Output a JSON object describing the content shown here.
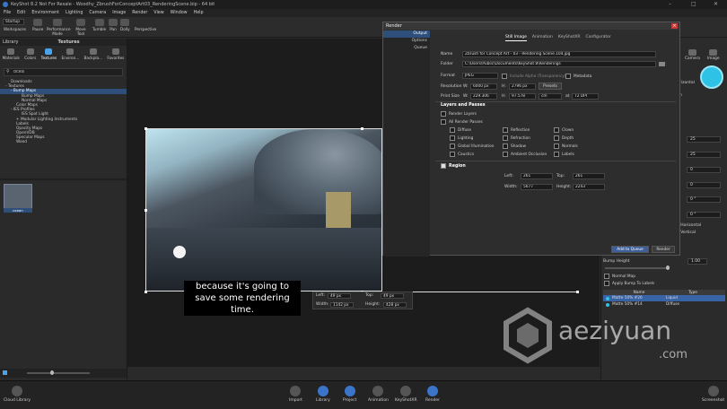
{
  "window": {
    "title": "KeyShot 8.2 Not For Resale - Woodhy_ZbrushForConceptArt03_RenderingScene.bip - 64 bit",
    "min_glyph": "–",
    "max_glyph": "□",
    "close_glyph": "✕"
  },
  "menu": [
    "File",
    "Edit",
    "Environment",
    "Lighting",
    "Camera",
    "Image",
    "Render",
    "View",
    "Window",
    "Help"
  ],
  "toolbar": {
    "workspace_select": "Startup",
    "items": [
      "Workspaces",
      "Pause",
      "Performance Mode",
      "Move Tool",
      "Tumble",
      "Pan",
      "Dolly",
      "Perspective"
    ]
  },
  "library": {
    "header": "Library",
    "panel_title": "Textures",
    "tabs": [
      "Materials",
      "Colors",
      "Textures",
      "Environ...",
      "Backpla...",
      "Favorites"
    ],
    "search_value": "ocea",
    "tree": [
      {
        "label": "Downloads",
        "indent": 1
      },
      {
        "label": "- Textures",
        "indent": 0
      },
      {
        "label": "- Bump Maps",
        "indent": 1,
        "selected": true
      },
      {
        "label": "Bump Maps",
        "indent": 2
      },
      {
        "label": "Normal Maps",
        "indent": 2
      },
      {
        "label": "Color Maps",
        "indent": 1
      },
      {
        "label": "- IES Profiles",
        "indent": 1
      },
      {
        "label": "IES Spot Light",
        "indent": 2
      },
      {
        "label": "+ Modular Lighting Instruments",
        "indent": 1
      },
      {
        "label": "Labels",
        "indent": 1
      },
      {
        "label": "Opacity Maps",
        "indent": 1
      },
      {
        "label": "OpenVDB",
        "indent": 1
      },
      {
        "label": "Specular Maps",
        "indent": 1
      },
      {
        "label": "Wood",
        "indent": 1
      }
    ],
    "thumb_label": "ocean"
  },
  "region_box": {
    "left_label": "Left:",
    "left_value": "49 px",
    "top_label": "Top:",
    "top_value": "49 px",
    "width_label": "Width:",
    "width_value": "1142 px",
    "height_label": "Height:",
    "height_value": "428 px"
  },
  "subtitle": {
    "line1": "because it's going to",
    "line2": "save some rendering time."
  },
  "right_panel": {
    "tabs": [
      "Camera",
      "Image"
    ],
    "label_bump_height": "Bump Height",
    "bump_value": "1.00",
    "label_normal_map": "Normal Map",
    "label_apply_bump": "Apply Bump To Labels",
    "labels_misc": [
      "rizontal",
      "n",
      "t Horizontal",
      "t Vertical"
    ],
    "fields": [
      "25",
      "25",
      "0",
      "0",
      "0 °",
      "0 °"
    ],
    "table_headers": [
      "",
      "Name",
      "Type"
    ],
    "table_rows": [
      {
        "name": "Matte 50% #26",
        "type": "Liquid",
        "selected": true
      },
      {
        "name": "Matte 50% #14",
        "type": "Diffuse",
        "selected": false
      }
    ]
  },
  "render_dialog": {
    "title": "Render",
    "close": "×",
    "nav": [
      "Output",
      "Options",
      "Queue"
    ],
    "tabs": [
      "Still Image",
      "Animation",
      "KeyShotXR",
      "Configurator"
    ],
    "name_label": "Name",
    "name_value": "Zbrush for Concept Art - 03 - Rendering Scene.104.jpg",
    "folder_label": "Folder",
    "folder_value": "C:\\Users\\Public\\Documents\\KeyShot 8\\Renderings",
    "format_label": "Format",
    "format_value": "JPEG",
    "include_alpha": "Include Alpha (Transparency)",
    "metadata": "Metadata",
    "resolution_label": "Resolution",
    "res_w_label": "W:",
    "res_w_value": "6000 px",
    "res_h_label": "H:",
    "res_h_value": "2796 px",
    "presets": "Presets",
    "print_size_label": "Print Size",
    "print_w_value": "229.306",
    "print_h_value": "97.578",
    "print_unit": "cm",
    "print_at": "at",
    "print_dpi": "72 DPI",
    "layers_section": "Layers and Passes",
    "render_layers": "Render Layers",
    "all_passes": "All Render Passes",
    "passes": [
      "Diffuse",
      "Reflection",
      "Clown",
      "Lighting",
      "Refraction",
      "Depth",
      "Global Illumination",
      "Shadow",
      "Normals",
      "Caustics",
      "Ambient Occlusion",
      "Labels"
    ],
    "region_section": "Region",
    "left_label": "Left:",
    "left_value": "261",
    "top_label": "Top:",
    "top_value": "261",
    "width_label": "Width:",
    "width_value": "5677",
    "height_label": "Height:",
    "height_value": "2243",
    "add_to_queue": "Add to Queue",
    "render_button": "Render"
  },
  "bottom_bar": {
    "left_item": "Cloud Library",
    "items": [
      "Import",
      "Library",
      "Project",
      "Animation",
      "KeyShotXR",
      "Render"
    ],
    "right_item": "Screenshot"
  },
  "watermark": {
    "text": "aeziyuan",
    "sub": ".com"
  }
}
